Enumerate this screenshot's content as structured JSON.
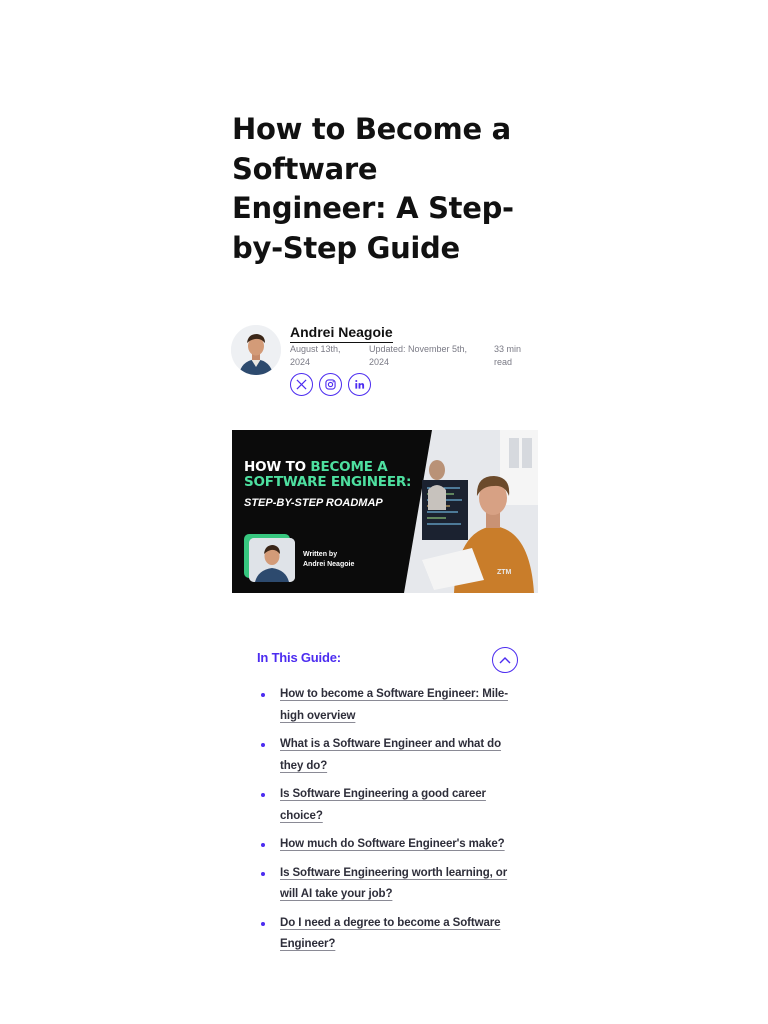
{
  "article": {
    "title": "How to Become a Software Engineer: A Step-by-Step Guide"
  },
  "author": {
    "name": "Andrei Neagoie",
    "published": "August 13th, 2024",
    "updated": "Updated: November 5th, 2024",
    "read_time": "33 min read",
    "socials": [
      {
        "icon": "x-icon"
      },
      {
        "icon": "instagram-icon"
      },
      {
        "icon": "linkedin-icon"
      }
    ]
  },
  "hero": {
    "line1_plain": "HOW TO ",
    "line1_highlight": "BECOME A",
    "line2": "SOFTWARE ENGINEER:",
    "subtitle": "STEP-BY-STEP ROADMAP",
    "written_by": "Written by",
    "author": "Andrei Neagoie",
    "logo": "ZTM",
    "highlight_color": "#4ee0a0"
  },
  "toc": {
    "title": "In This Guide:",
    "toggle_icon": "chevron-up-icon",
    "items": [
      "How to become a Software Engineer: Mile-high overview",
      "What is a Software Engineer and what do they do?",
      "Is Software Engineering a good career choice?",
      "How much do Software Engineer's make?",
      "Is Software Engineering worth learning, or will AI take your job?",
      "Do I need a degree to become a Software Engineer?"
    ]
  },
  "colors": {
    "accent": "#4c2cf0",
    "text": "#111111",
    "muted": "#7a7a85"
  }
}
